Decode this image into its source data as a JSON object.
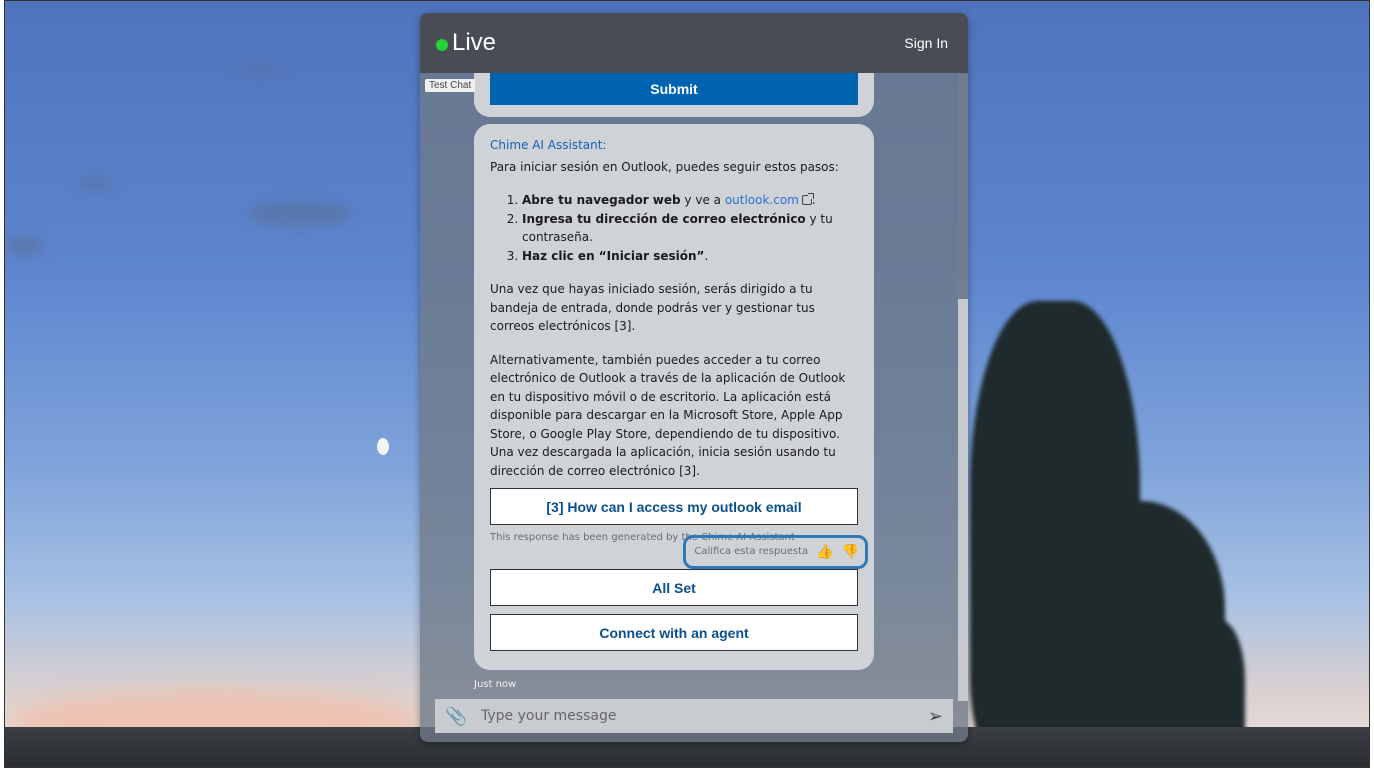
{
  "header": {
    "status": "Live",
    "signin_label": "Sign In"
  },
  "badge": "Test Chat",
  "previous": {
    "submit_label": "Submit"
  },
  "message": {
    "sender": "Chime AI Assistant:",
    "intro": "Para iniciar sesión en Outlook, puedes seguir estos pasos:",
    "steps": [
      {
        "bold": "Abre tu navegador web",
        "rest_before": " y ve a ",
        "link": "outlook.com",
        "rest_after": "."
      },
      {
        "bold": "Ingresa tu dirección de correo electrónico",
        "rest": " y tu contraseña."
      },
      {
        "bold": "Haz clic en “Iniciar sesión”",
        "rest": "."
      }
    ],
    "para1": "Una vez que hayas iniciado sesión, serás dirigido a tu bandeja de entrada, donde podrás ver y gestionar tus correos electrónicos [3].",
    "para2": "Alternativamente, también puedes acceder a tu correo electrónico de Outlook a través de la aplicación de Outlook en tu dispositivo móvil o de escritorio. La aplicación está disponible para descargar en la Microsoft Store, Apple App Store, o Google Play Store, dependiendo de tu dispositivo. Una vez descargada la aplicación, inicia sesión usando tu dirección de correo electrónico [3].",
    "source_button": "[3] How can I access my outlook email",
    "generated_note": "This response has been generated by the Chime AI Assistant",
    "rate_label": "Califica esta respuesta",
    "all_set_label": "All Set",
    "agent_label": "Connect with an agent",
    "timestamp": "Just now"
  },
  "input": {
    "placeholder": "Type your message"
  },
  "icons": {
    "attach": "paperclip-icon",
    "send": "send-icon",
    "thumbs_up": "thumbs-up-icon",
    "thumbs_down": "thumbs-down-icon",
    "external": "external-link-icon"
  },
  "colors": {
    "accent": "#0063b1",
    "live": "#25d03a",
    "link": "#2b6fd6",
    "highlight": "#2f78b7"
  }
}
